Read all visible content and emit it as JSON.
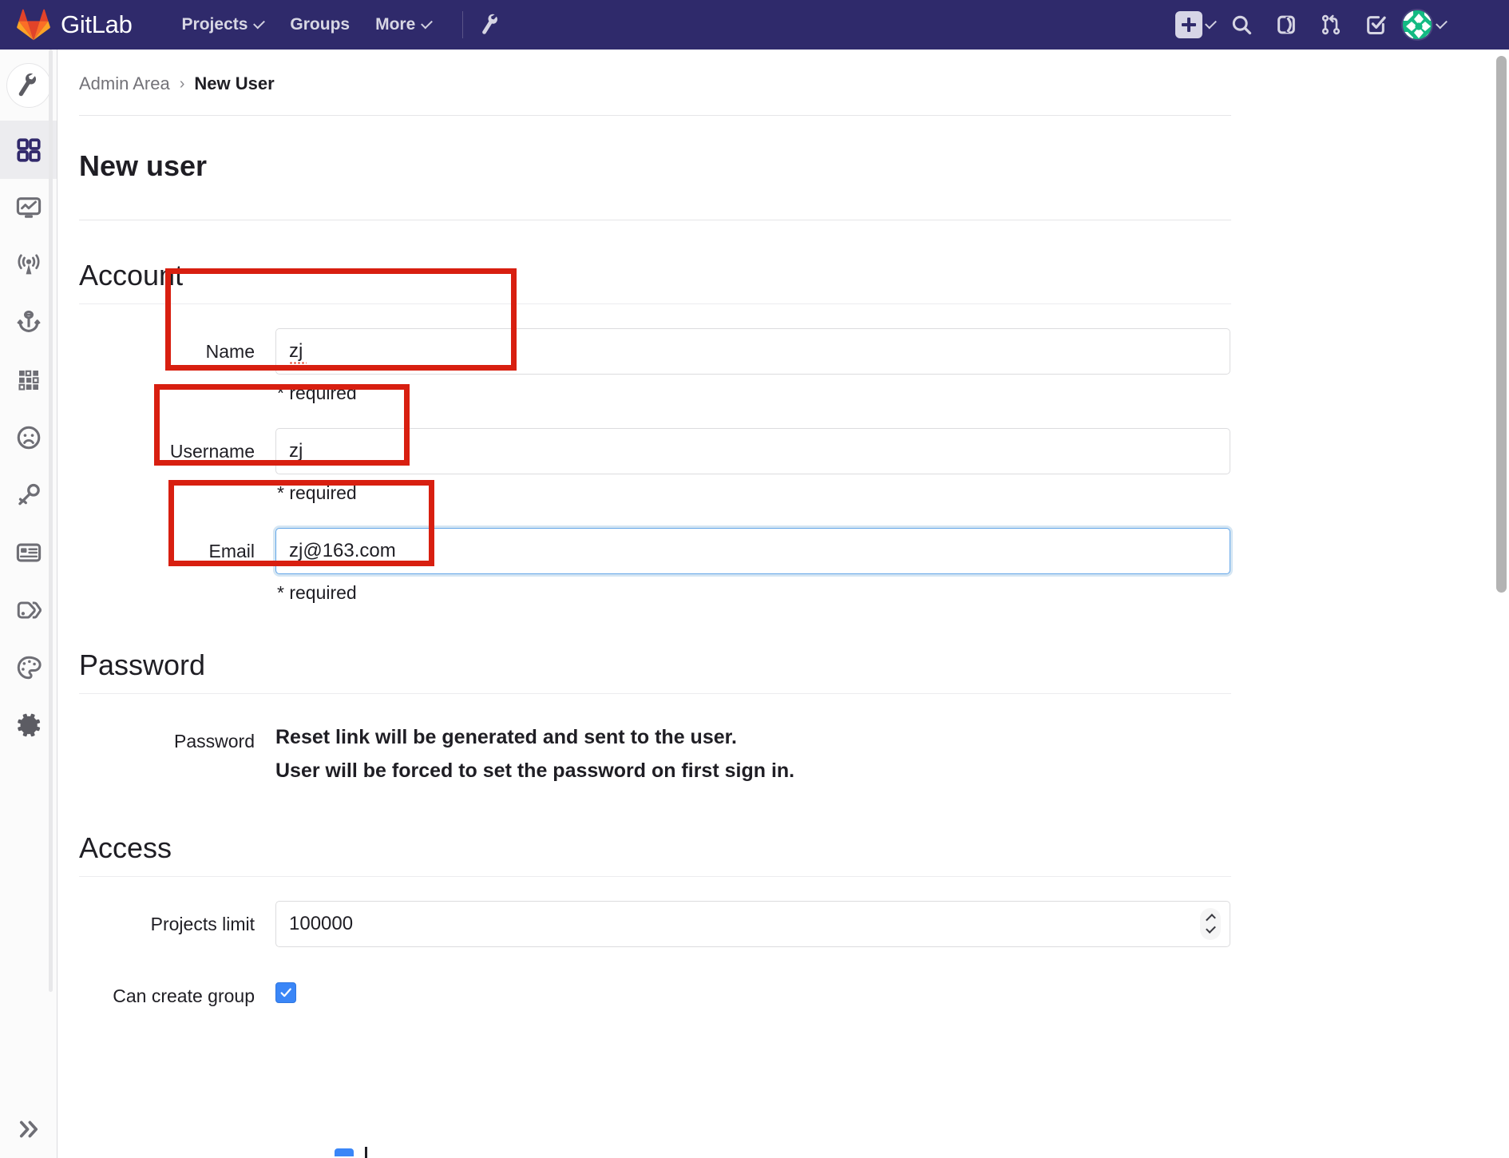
{
  "navbar": {
    "brand": "GitLab",
    "brand_logo_icon": "gitlab-tanuki-logo",
    "links": [
      {
        "label": "Projects",
        "has_caret": true
      },
      {
        "label": "Groups",
        "has_caret": false
      },
      {
        "label": "More",
        "has_caret": true
      }
    ],
    "admin_wrench_icon": "wrench-icon",
    "right_icons": [
      {
        "name": "new-dropdown",
        "icon": "plus-square-icon"
      },
      {
        "name": "search",
        "icon": "search-icon"
      },
      {
        "name": "issues",
        "icon": "issues-icon"
      },
      {
        "name": "merge-requests",
        "icon": "merge-request-icon"
      },
      {
        "name": "todos",
        "icon": "todo-done-icon"
      },
      {
        "name": "user-avatar",
        "icon": "avatar-icon"
      }
    ],
    "background_color": "#2f2a6b"
  },
  "sidebar": {
    "top_icon": "wrench-icon",
    "items": [
      {
        "name": "overview",
        "icon": "dashboard-grid-icon",
        "active": true
      },
      {
        "name": "monitoring",
        "icon": "monitor-chart-icon",
        "active": false
      },
      {
        "name": "system-hooks",
        "icon": "broadcast-antenna-icon",
        "active": false
      },
      {
        "name": "deploy-keys",
        "icon": "anchor-hook-icon",
        "active": false
      },
      {
        "name": "applications",
        "icon": "grid-dots-icon",
        "active": false
      },
      {
        "name": "abuse-reports",
        "icon": "frown-face-icon",
        "active": false
      },
      {
        "name": "license",
        "icon": "key-icon",
        "active": false
      },
      {
        "name": "messages",
        "icon": "id-card-icon",
        "active": false
      },
      {
        "name": "labels",
        "icon": "labels-tag-icon",
        "active": false
      },
      {
        "name": "appearance",
        "icon": "palette-icon",
        "active": false
      },
      {
        "name": "settings",
        "icon": "gear-icon",
        "active": false
      }
    ],
    "collapse_icon": "chevron-double-right-icon"
  },
  "breadcrumb": {
    "root": "Admin Area",
    "separator": "›",
    "current": "New User"
  },
  "page": {
    "title": "New user"
  },
  "sections": {
    "account": {
      "heading": "Account",
      "fields": [
        {
          "label": "Name",
          "value": "zj",
          "hint": "* required",
          "focused": false,
          "misspelled": true,
          "annotated": true
        },
        {
          "label": "Username",
          "value": "zj",
          "hint": "* required",
          "focused": false,
          "misspelled": false,
          "annotated": true
        },
        {
          "label": "Email",
          "value": "zj@163.com",
          "hint": "* required",
          "focused": true,
          "misspelled": false,
          "annotated": true
        }
      ]
    },
    "password": {
      "heading": "Password",
      "label": "Password",
      "line1": "Reset link will be generated and sent to the user.",
      "line2": "User will be forced to set the password on first sign in."
    },
    "access": {
      "heading": "Access",
      "projects_limit": {
        "label": "Projects limit",
        "value": "100000",
        "stepper_icon": "spinner-up-down-icon"
      },
      "can_create_group": {
        "label": "Can create group",
        "checked": true,
        "check_icon": "check-mark-icon"
      }
    }
  },
  "colors": {
    "navbar": "#2f2a6b",
    "annotation": "#d81f10",
    "focus_ring": "#63a6e9",
    "checkbox": "#3a86f7",
    "text": "#1f1e24",
    "muted": "#737278"
  }
}
